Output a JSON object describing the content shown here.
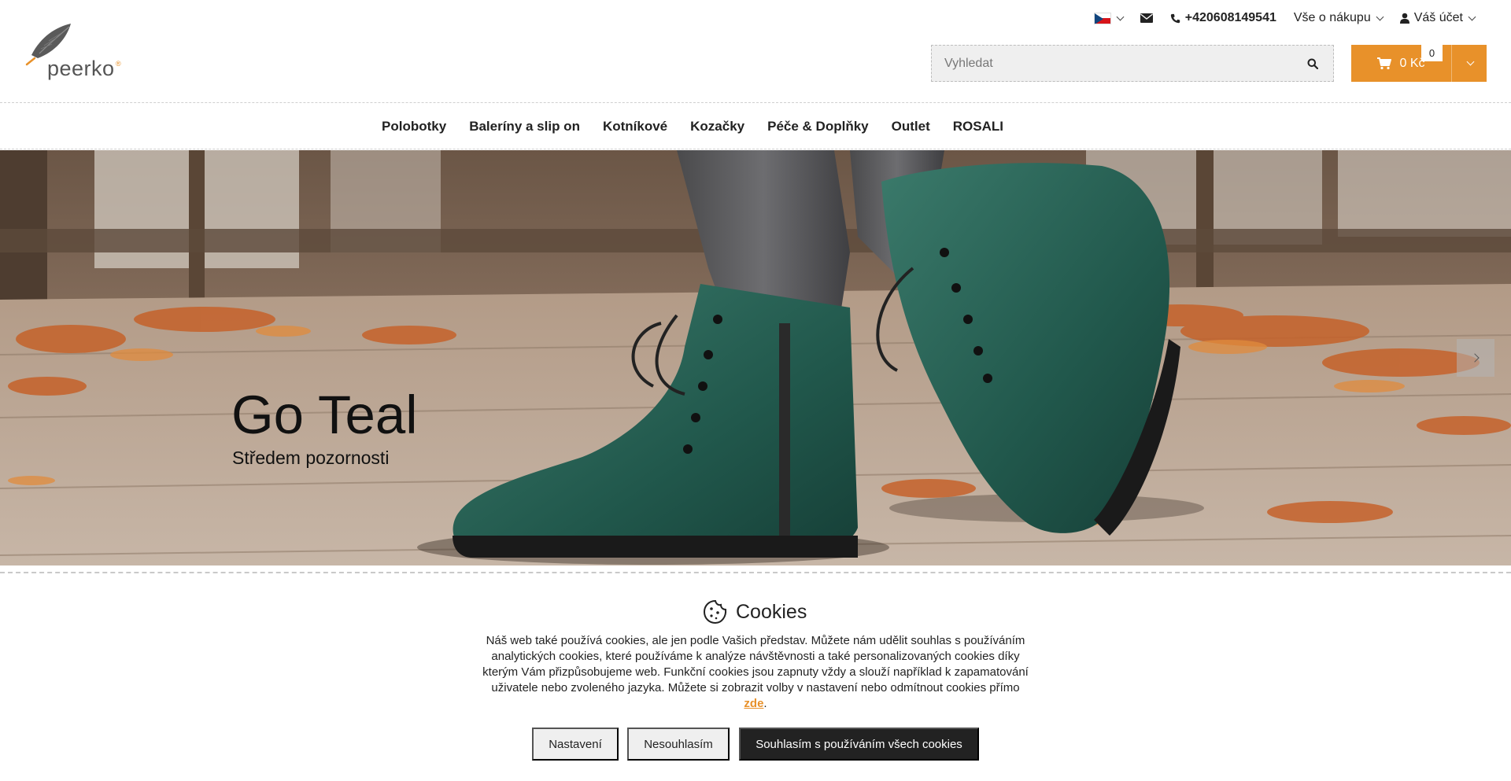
{
  "brand": {
    "name": "peerko",
    "reg": "®"
  },
  "topbar": {
    "language_icon": "czech-flag-icon",
    "phone": "+420608149541",
    "shopping_menu": "Vše o nákupu",
    "account_menu": "Váš účet"
  },
  "search": {
    "placeholder": "Vyhledat"
  },
  "cart": {
    "total": "0 Kč",
    "count": "0"
  },
  "nav": {
    "items": [
      "Polobotky",
      "Baleríny a slip on",
      "Kotníkové",
      "Kozačky",
      "Péče & Doplňky",
      "Outlet",
      "ROSALI"
    ]
  },
  "hero": {
    "title": "Go Teal",
    "subtitle": "Středem pozornosti"
  },
  "cookies": {
    "title": "Cookies",
    "text": "Náš web také používá cookies, ale jen podle Vašich představ. Můžete nám udělit souhlas s používáním analytických cookies, které používáme k analýze návštěvnosti a také personalizovaných cookies díky kterým Vám přizpůsobujeme web. Funkční cookies jsou zapnuty vždy a slouží například k zapamatování uživatele nebo zvoleného jazyka. Můžete si zobrazit volby v nastavení nebo odmítnout cookies přímo",
    "link": "zde",
    "link_suffix": ".",
    "btn_settings": "Nastavení",
    "btn_decline": "Nesouhlasím",
    "btn_accept": "Souhlasím s používáním všech cookies"
  },
  "colors": {
    "accent": "#e8912a",
    "dark": "#222222",
    "teal": "#1f5a4e"
  }
}
